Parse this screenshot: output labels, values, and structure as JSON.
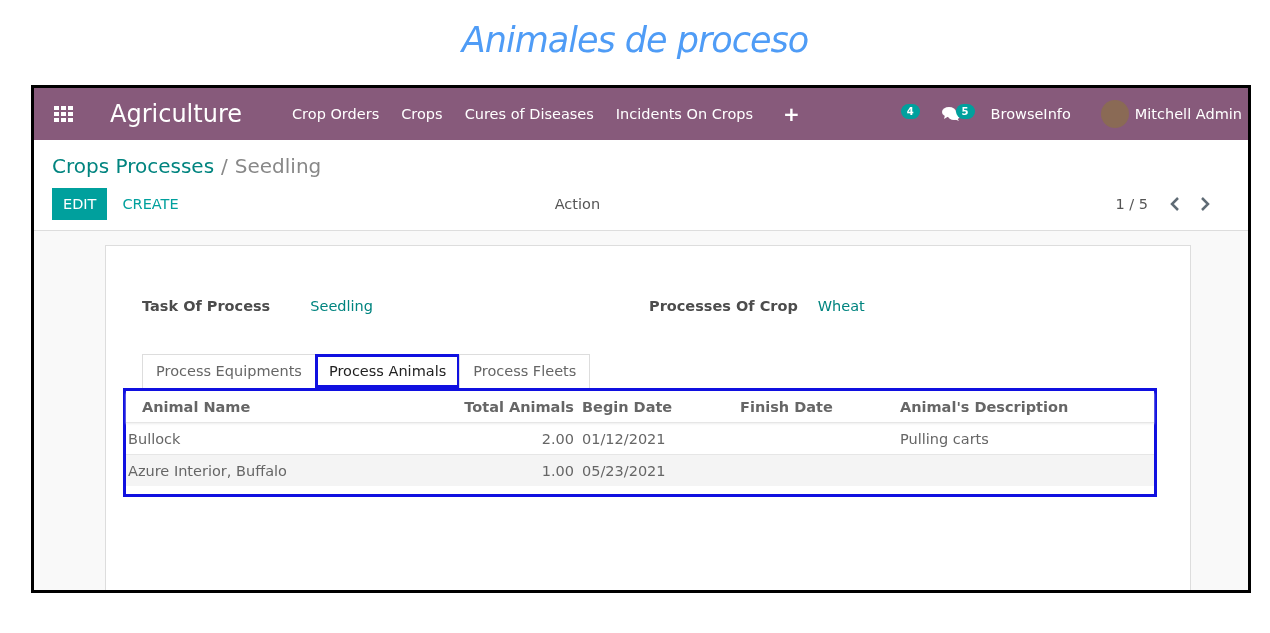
{
  "page_title": "Animales de proceso",
  "navbar": {
    "app_name": "Agriculture",
    "menu": [
      "Crop Orders",
      "Crops",
      "Cures of Diseases",
      "Incidents On Crops"
    ],
    "add_symbol": "+",
    "activity_count": "4",
    "message_count": "5",
    "company": "BrowseInfo",
    "user": "Mitchell Admin"
  },
  "breadcrumb": {
    "parent": "Crops Processes",
    "separator": "/",
    "current": "Seedling"
  },
  "buttons": {
    "edit": "EDIT",
    "create": "CREATE",
    "action": "Action"
  },
  "pager": "1 / 5",
  "fields": [
    {
      "label": "Task Of Process",
      "value": "Seedling"
    },
    {
      "label": "Processes Of Crop",
      "value": "Wheat"
    }
  ],
  "tabs": [
    {
      "label": "Process Equipments",
      "selected": false
    },
    {
      "label": "Process Animals",
      "selected": true
    },
    {
      "label": "Process Fleets",
      "selected": false
    }
  ],
  "table": {
    "columns": [
      "Animal Name",
      "Total Animals",
      "Begin Date",
      "Finish Date",
      "Animal's Description"
    ],
    "rows": [
      [
        "Bullock",
        "2.00",
        "01/12/2021",
        "",
        "Pulling carts"
      ],
      [
        "Azure Interior, Buffalo",
        "1.00",
        "05/23/2021",
        "",
        ""
      ]
    ]
  }
}
